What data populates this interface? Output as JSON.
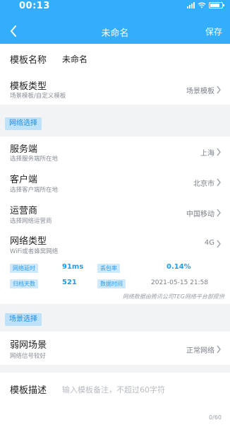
{
  "status_bar": {
    "time": "00:13"
  },
  "nav": {
    "title": "未命名",
    "save_label": "保存"
  },
  "template_name": {
    "label": "模板名称",
    "value": "未命名"
  },
  "template_type": {
    "label": "模板类型",
    "sub": "场景模板/自定义模板",
    "value": "场景模板"
  },
  "network_section": {
    "tag": "网络选择"
  },
  "server": {
    "label": "服务端",
    "sub": "选择服务端所在地",
    "value": "上海"
  },
  "client": {
    "label": "客户端",
    "sub": "选择客户端所在地",
    "value": "北京市"
  },
  "carrier": {
    "label": "运营商",
    "sub": "选择网络运营商",
    "value": "中国移动"
  },
  "network_type": {
    "label": "网络类型",
    "sub": "WiFi或者蜂窝网络",
    "value": "4G"
  },
  "stats": {
    "latency_label": "网络延时",
    "latency_value": "91ms",
    "loss_label": "丢包率",
    "loss_value": "0.14%",
    "samples_label": "归档天数",
    "samples_value": "521",
    "time_label": "数据时间",
    "time_value": "2021-05-15 21:58",
    "footnote": "网络数据由腾讯公司TEG网络平台部提供"
  },
  "scene_section": {
    "tag": "场景选择"
  },
  "weak_network": {
    "label": "弱网场景",
    "sub": "网络信号较好",
    "value": "正常网络"
  },
  "description": {
    "label": "模板描述",
    "placeholder": "输入模板备注，不超过60字符",
    "counter": "0/60"
  },
  "colors": {
    "header": "#32aefc",
    "accent": "#1e9cf0"
  }
}
